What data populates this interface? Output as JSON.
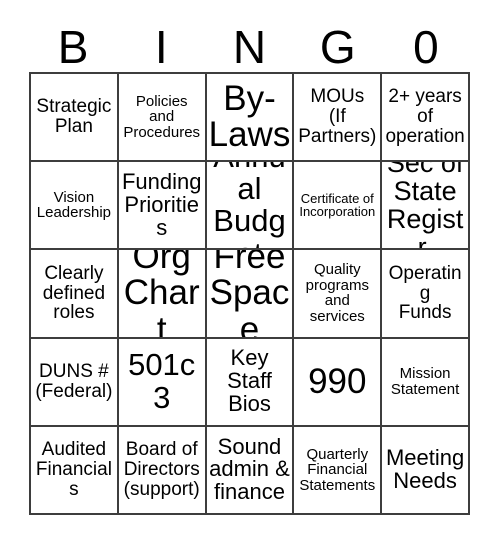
{
  "card": {
    "header_letters": [
      "B",
      "I",
      "N",
      "G",
      "0"
    ],
    "rows": [
      [
        {
          "text": "Strategic\nPlan",
          "size": "fs-md"
        },
        {
          "text": "Policies\nand\nProcedures",
          "size": "fs-sm"
        },
        {
          "text": "By-\nLaws",
          "size": "fs-huge"
        },
        {
          "text": "MOUs\n(If\nPartners)",
          "size": "fs-md"
        },
        {
          "text": "2+ years\nof\noperation",
          "size": "fs-md"
        }
      ],
      [
        {
          "text": "Vision\nLeadership",
          "size": "fs-sm"
        },
        {
          "text": "Funding\nPriorities",
          "size": "fs-lg"
        },
        {
          "text": "Annual\nBudget",
          "size": "fs-xxl"
        },
        {
          "text": "Certificate of\nIncorporation",
          "size": "fs-xs"
        },
        {
          "text": "Sec of\nState\nRegistr.",
          "size": "fs-xl"
        }
      ],
      [
        {
          "text": "Clearly\ndefined\nroles",
          "size": "fs-md"
        },
        {
          "text": "Org\nChart",
          "size": "fs-huge"
        },
        {
          "text": "Free\nSpace",
          "size": "fs-huge"
        },
        {
          "text": "Quality\nprograms\nand\nservices",
          "size": "fs-sm"
        },
        {
          "text": "Operating\nFunds",
          "size": "fs-md"
        }
      ],
      [
        {
          "text": "DUNS #\n(Federal)",
          "size": "fs-md"
        },
        {
          "text": "501c3",
          "size": "fs-xxl"
        },
        {
          "text": "Key\nStaff\nBios",
          "size": "fs-lg"
        },
        {
          "text": "990",
          "size": "fs-huge"
        },
        {
          "text": "Mission\nStatement",
          "size": "fs-sm"
        }
      ],
      [
        {
          "text": "Audited\nFinancials",
          "size": "fs-md"
        },
        {
          "text": "Board of\nDirectors\n(support)",
          "size": "fs-md"
        },
        {
          "text": "Sound\nadmin &\nfinance",
          "size": "fs-lg"
        },
        {
          "text": "Quarterly\nFinancial\nStatements",
          "size": "fs-sm"
        },
        {
          "text": "Meeting\nNeeds",
          "size": "fs-lg"
        }
      ]
    ]
  }
}
